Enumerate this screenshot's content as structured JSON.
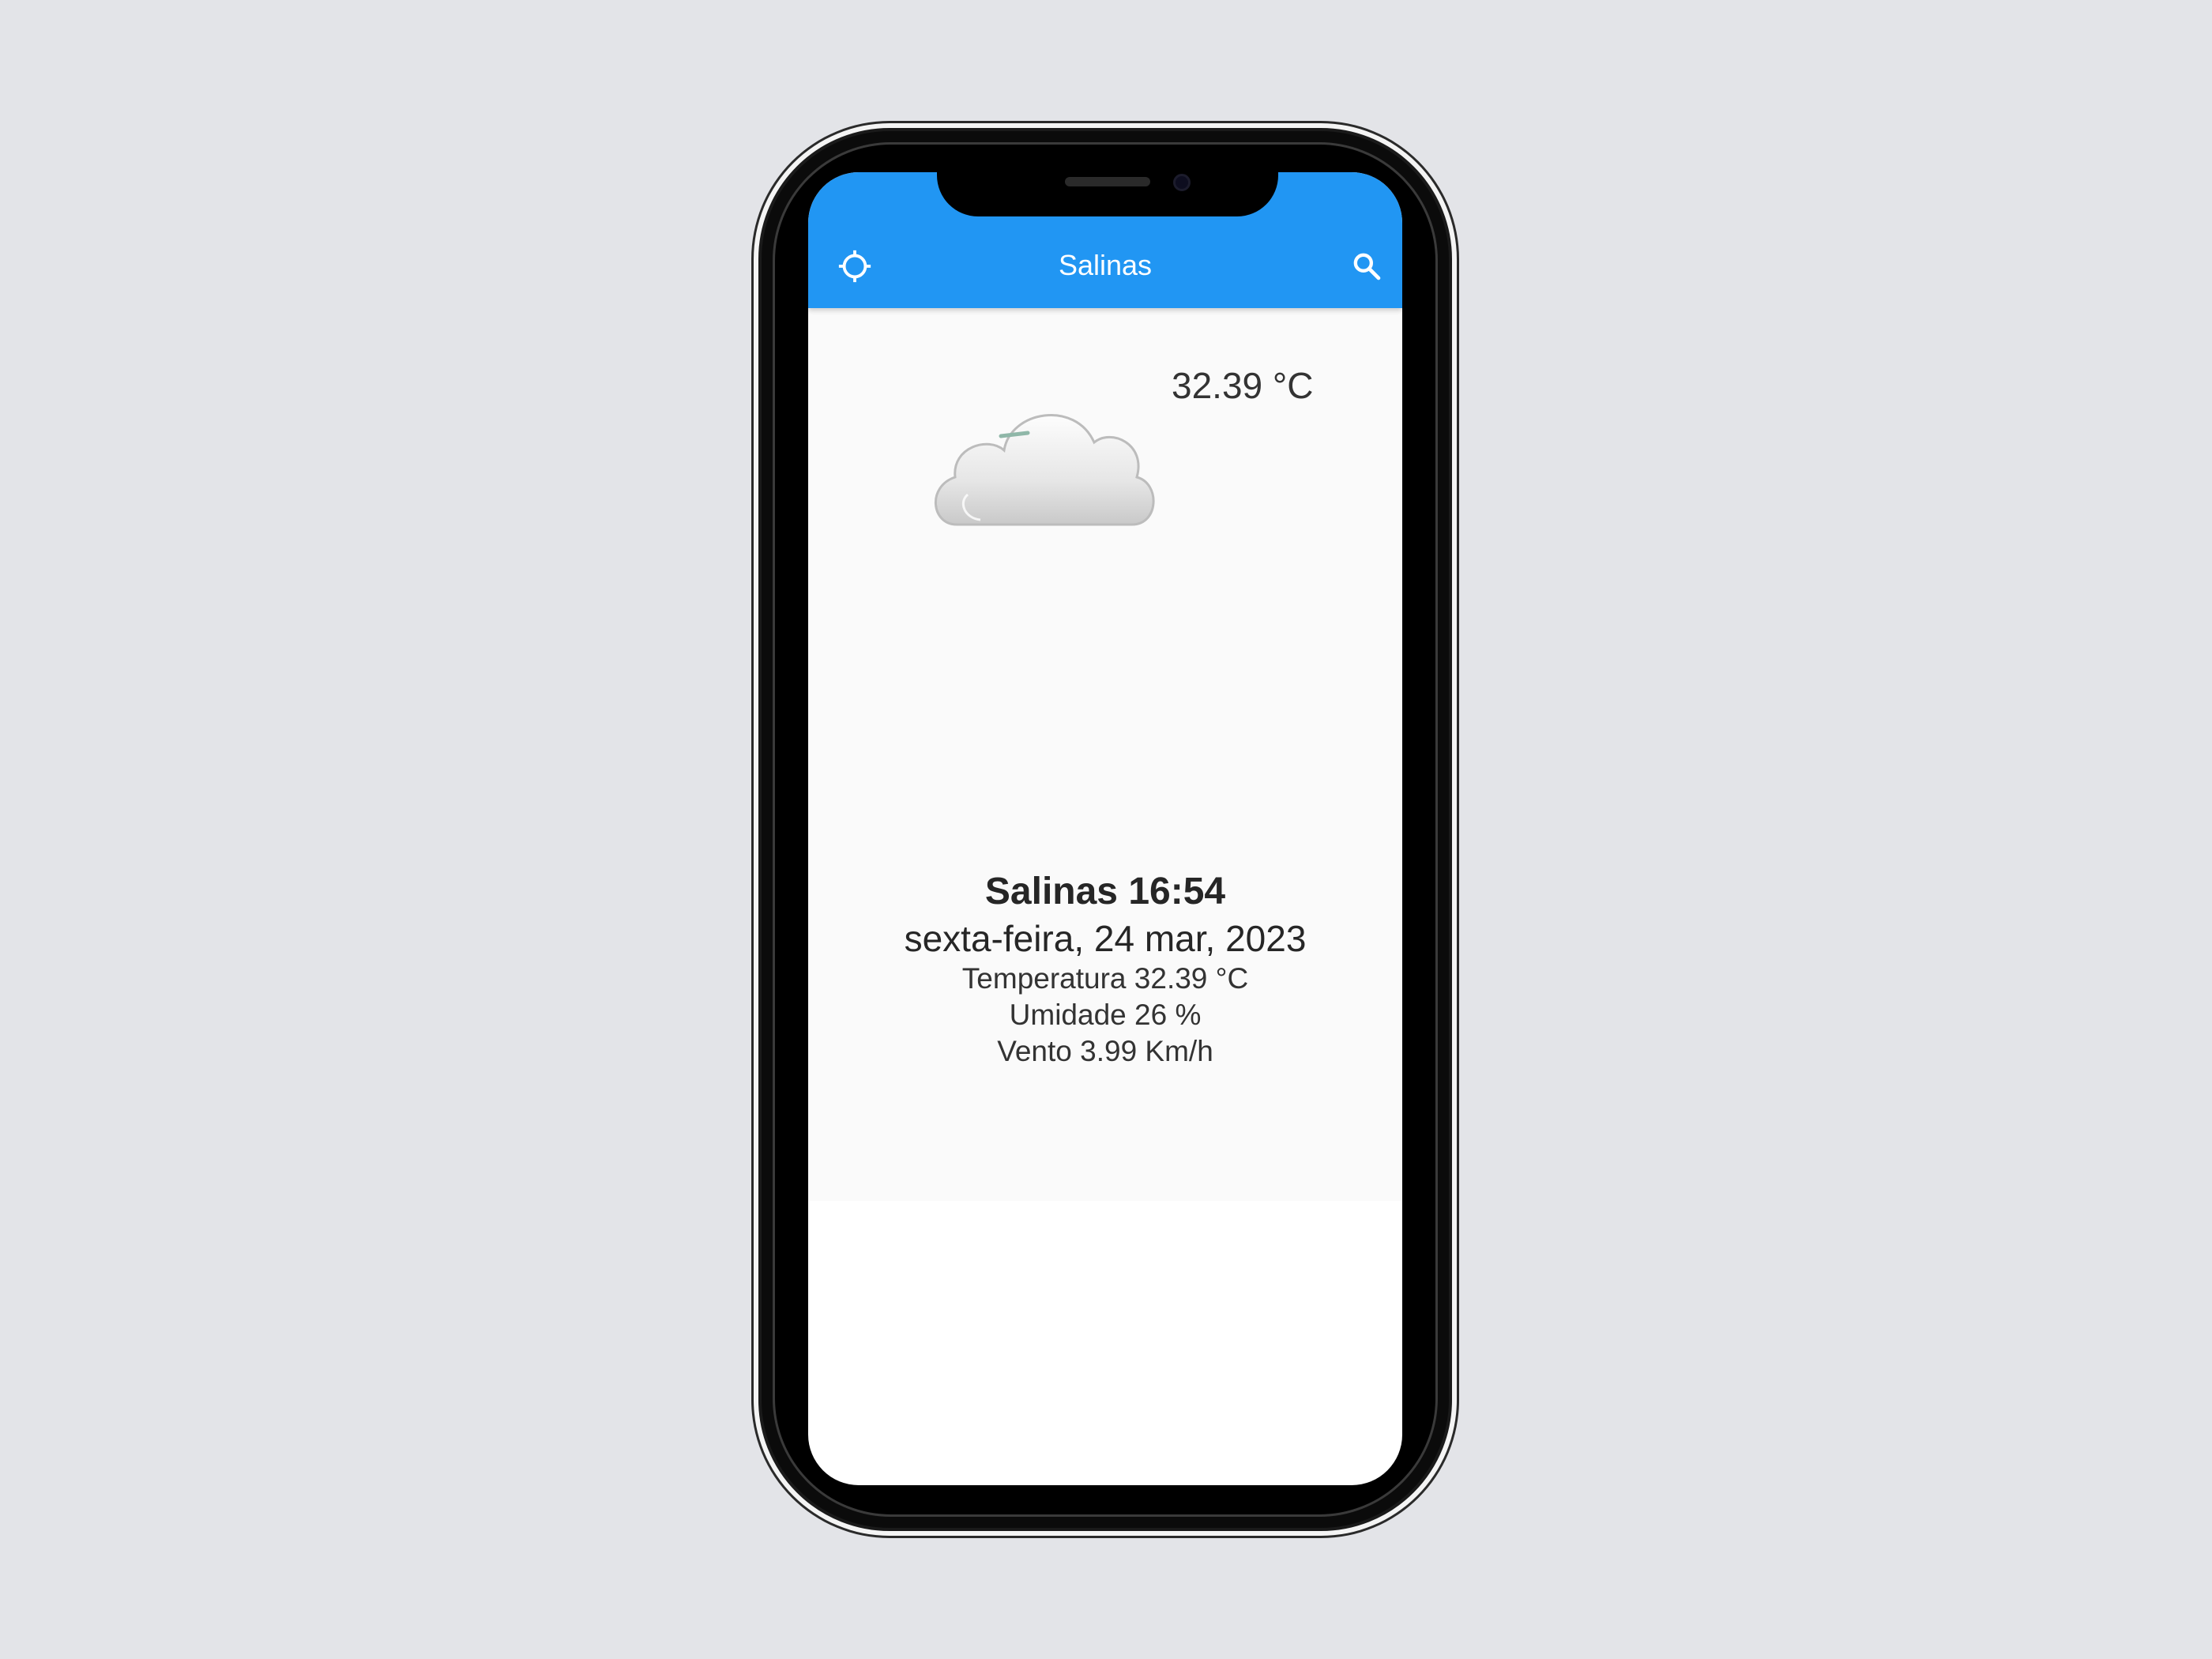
{
  "app_bar": {
    "title": "Salinas",
    "left_icon": "gps-locate-icon",
    "right_icon": "search-icon",
    "color": "#2196f3"
  },
  "weather": {
    "current_temp": "32.39 °C",
    "condition_icon": "cloud-icon",
    "city_time": "Salinas 16:54",
    "date": "sexta-feira, 24 mar, 2023",
    "temperature_line": "Temperatura 32.39 °C",
    "humidity_line": "Umidade 26 %",
    "wind_line": "Vento 3.99 Km/h"
  }
}
